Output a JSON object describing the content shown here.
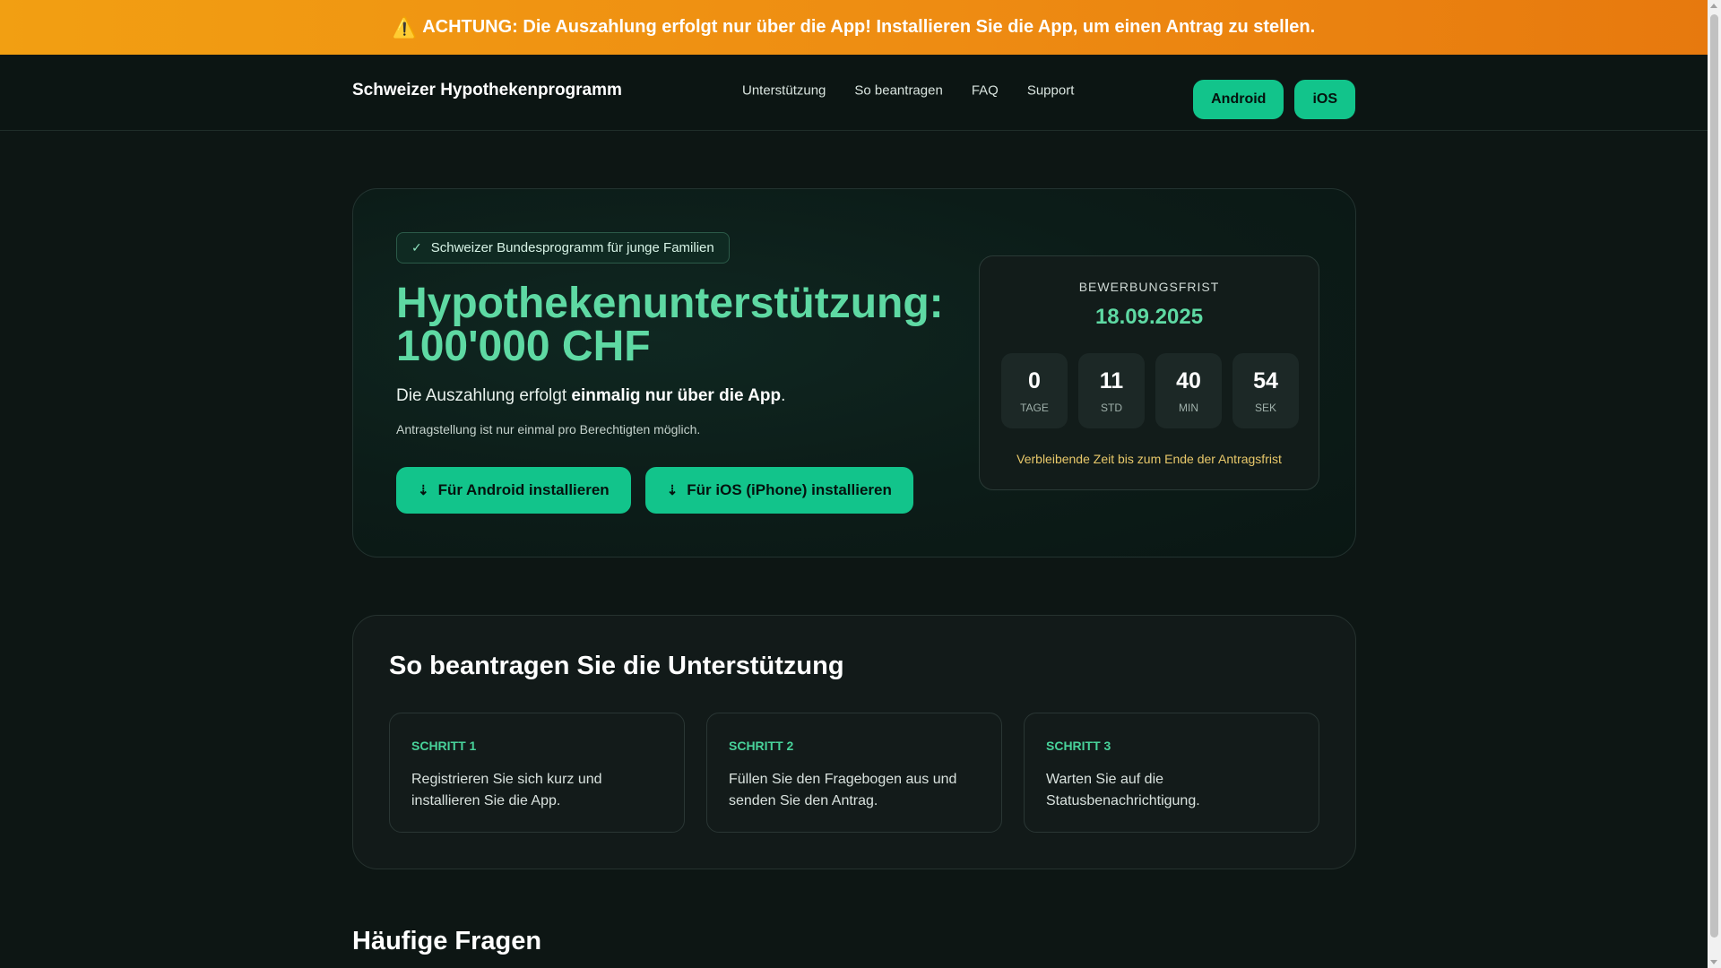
{
  "alert": {
    "icon": "warning-icon",
    "text": "ACHTUNG: Die Auszahlung erfolgt nur über die App! Installieren Sie die App, um einen Antrag zu stellen."
  },
  "header": {
    "brand": "Schweizer Hypothekenprogramm",
    "nav": [
      "Unterstützung",
      "So beantragen",
      "FAQ",
      "Support"
    ],
    "android_label": "Android",
    "ios_label": "iOS"
  },
  "hero": {
    "badge": "Schweizer Bundesprogramm für junge Familien",
    "title_line1": "Hypothekenunterstützung:",
    "title_line2": "100'000 CHF",
    "subtitle_pre": "Die Auszahlung erfolgt ",
    "subtitle_bold": "einmalig nur über die App",
    "subtitle_post": ".",
    "note": "Antragstellung ist nur einmal pro Berechtigten möglich.",
    "btn_android": "Für Android installieren",
    "btn_ios": "Für iOS (iPhone) installieren"
  },
  "countdown": {
    "label": "BEWERBUNGSFRIST",
    "date": "18.09.2025",
    "units": [
      {
        "value": "0",
        "unit": "TAGE"
      },
      {
        "value": "11",
        "unit": "STD"
      },
      {
        "value": "40",
        "unit": "MIN"
      },
      {
        "value": "54",
        "unit": "SEK"
      }
    ],
    "footer": "Verbleibende Zeit bis zum Ende der Antragsfrist"
  },
  "steps": {
    "title": "So beantragen Sie die Unterstützung",
    "items": [
      {
        "label": "SCHRITT 1",
        "text": "Registrieren Sie sich kurz und installieren Sie die App."
      },
      {
        "label": "SCHRITT 2",
        "text": "Füllen Sie den Fragebogen aus und senden Sie den Antrag."
      },
      {
        "label": "SCHRITT 3",
        "text": "Warten Sie auf die Statusbenachrichtigung."
      }
    ]
  },
  "faq": {
    "title": "Häufige Fragen"
  },
  "colors": {
    "accent": "#12c48b",
    "title_green": "#5ed9a3",
    "banner": "#ee8c12",
    "warning_text": "#e8c86a"
  }
}
